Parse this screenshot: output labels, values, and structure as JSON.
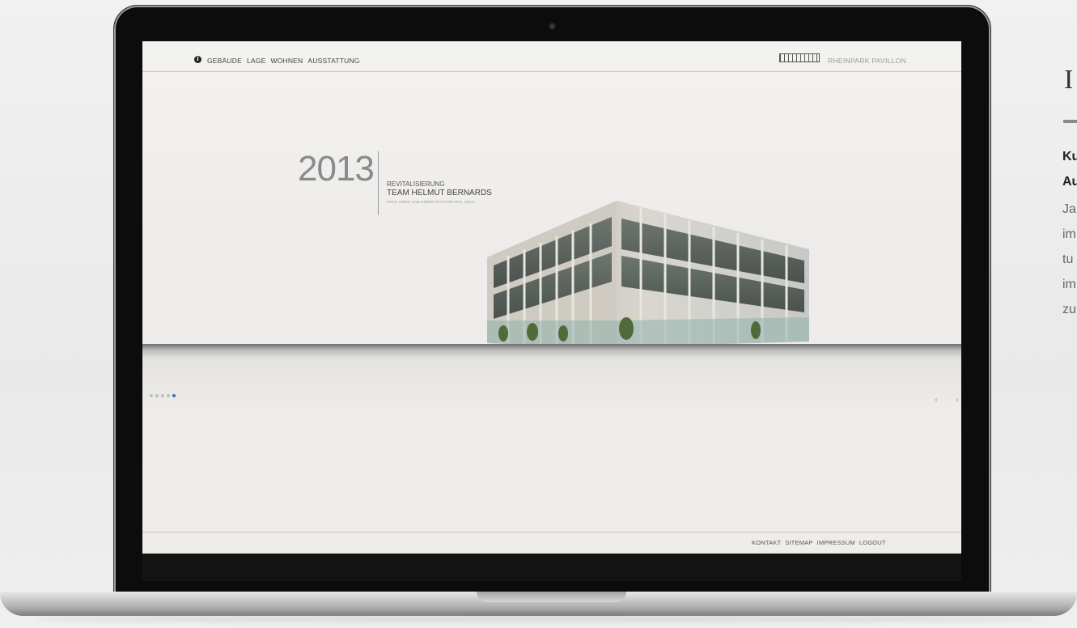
{
  "nav": {
    "items": [
      "GEBÄUDE",
      "LAGE",
      "WOHNEN",
      "AUSSTATTUNG"
    ]
  },
  "brand": {
    "name": "RHEINPARK PAVILLON"
  },
  "hero": {
    "year": "2013",
    "subtitle": "REVITALISIERUNG",
    "title": "TEAM HELMUT BERNARDS",
    "credit": "OPUS GMBH UND EIMER ARCHITEKTEN, KÖLN"
  },
  "slider": {
    "count": 5,
    "active": 5,
    "prev": "‹",
    "next": "›"
  },
  "footer": {
    "items": [
      "KONTAKT",
      "SITEMAP",
      "IMPRESSUM",
      "LOGOUT"
    ]
  },
  "side": {
    "heading": "I",
    "bold": [
      "Ku",
      "Au"
    ],
    "lines": [
      "Ja",
      "im",
      "tu",
      "im",
      "zu"
    ]
  },
  "colors": {
    "accent": "#3a6fa8",
    "dot": "#bdbdbd",
    "bezel": "#0c0c0c"
  },
  "icons": {
    "info": "info-icon",
    "logo": "building-logo-icon"
  }
}
